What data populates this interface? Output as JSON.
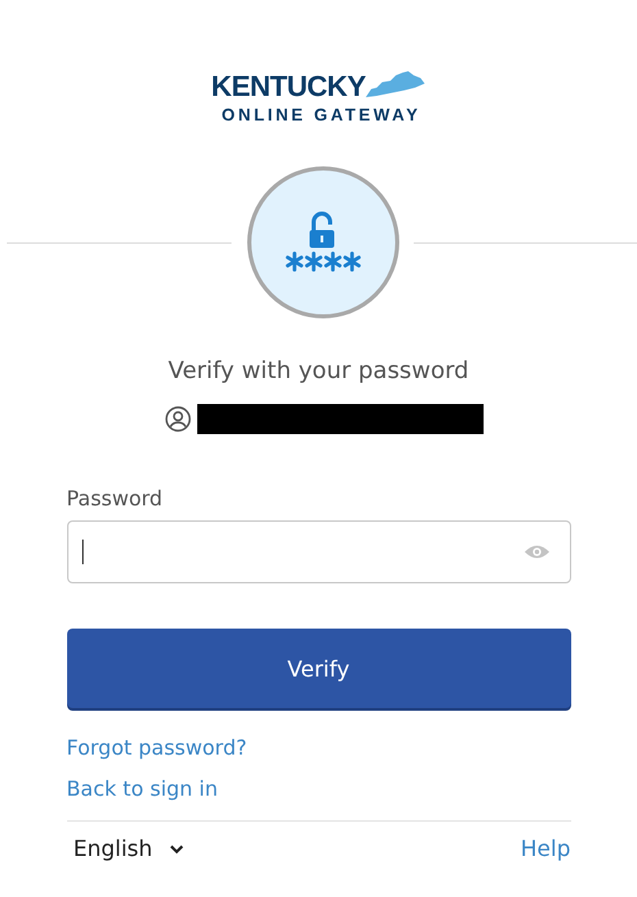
{
  "logo": {
    "line_1": "KENTUCKY",
    "line_2": "ONLINE GATEWAY"
  },
  "title": "Verify with your password",
  "password_field": {
    "label": "Password"
  },
  "verify_button": "Verify",
  "links": [
    "Forgot password?",
    "Back to sign in"
  ],
  "footer": {
    "language": "English",
    "help": "Help"
  }
}
